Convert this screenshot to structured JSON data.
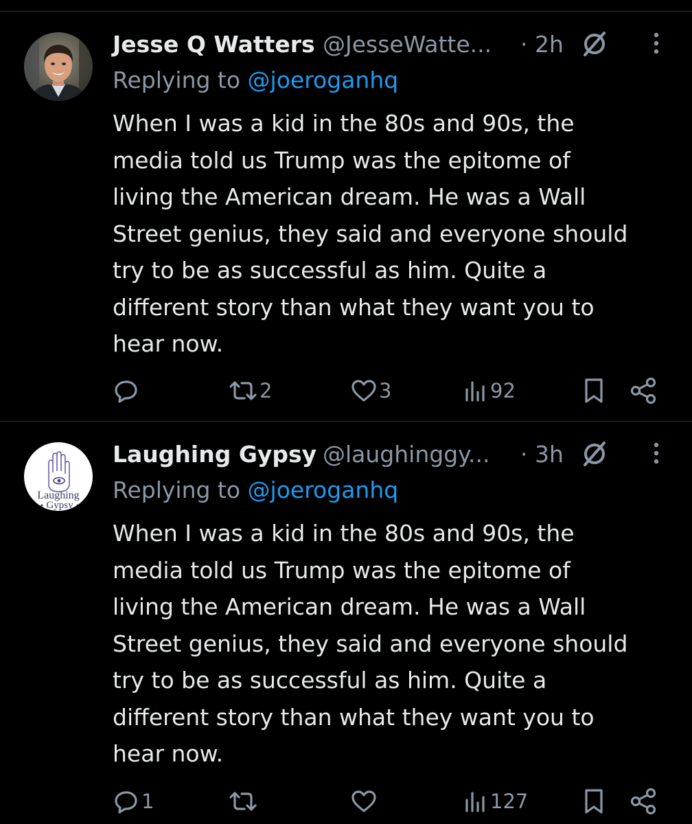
{
  "colors": {
    "background": "#000000",
    "text_primary": "#e7e9ea",
    "text_secondary": "#8b98a5",
    "link": "#1d9bf0",
    "divider": "#2f3336"
  },
  "tweets": [
    {
      "author_name": "Jesse Q Watters",
      "handle": "@JesseWatte...",
      "time": "· 2h",
      "reply_prefix": "Replying to ",
      "reply_mention": "@joeroganhq",
      "text": "When I was a kid in the 80s and 90s, the\nmedia told us Trump was the epitome of\nliving the American dream. He was a Wall\nStreet genius, they said and everyone should\ntry to be as successful as him. Quite a\ndifferent story than what they want you to\nhear now.",
      "avatar_icon": "profile-photo-man",
      "actions": {
        "reply_count": "",
        "retweet_count": "2",
        "like_count": "3",
        "views_count": "92"
      }
    },
    {
      "author_name": "Laughing Gypsy",
      "handle": "@laughinggy...",
      "time": "· 3h",
      "reply_prefix": "Replying to ",
      "reply_mention": "@joeroganhq",
      "text": "When I was a kid in the 80s and 90s, the\nmedia told us Trump was the epitome of\nliving the American dream. He was a Wall\nStreet genius, they said and everyone should\ntry to be as successful as him. Quite a\ndifferent story than what they want you to\nhear now.",
      "avatar_icon": "hamsa-hand-logo",
      "avatar_logo_text": [
        "Laughing",
        "Gypsy"
      ],
      "actions": {
        "reply_count": "1",
        "retweet_count": "",
        "like_count": "",
        "views_count": "127"
      }
    }
  ]
}
